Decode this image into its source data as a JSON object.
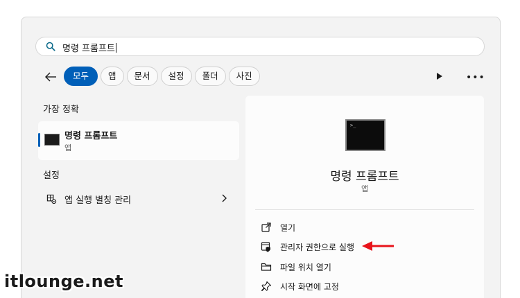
{
  "search": {
    "query": "명령 프롬프트"
  },
  "filters": [
    "모두",
    "앱",
    "문서",
    "설정",
    "폴더",
    "사진"
  ],
  "best_match": {
    "header": "가장 정확",
    "title": "명령 프롬프트",
    "subtitle": "앱"
  },
  "settings": {
    "header": "설정",
    "item_label": "앱 실행 별칭 관리"
  },
  "detail": {
    "title": "명령 프롬프트",
    "subtitle": "앱",
    "actions": [
      "열기",
      "관리자 권한으로 실행",
      "파일 위치 열기",
      "시작 화면에 고정"
    ]
  },
  "annotation": {
    "arrow_color": "#e8141b"
  },
  "colors": {
    "accent": "#005fb8"
  },
  "watermark": "itlounge.net"
}
